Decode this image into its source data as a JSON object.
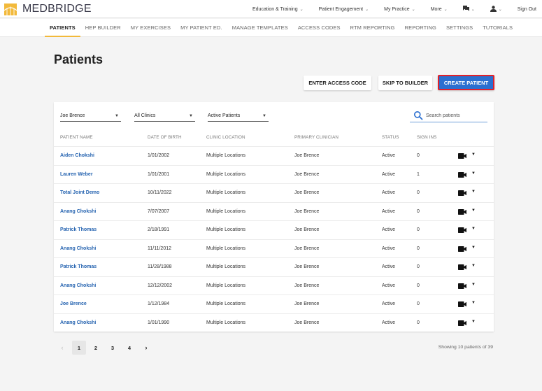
{
  "brand": {
    "name": "MEDBRIDGE",
    "logo_icon": "medbridge-bridge-logo",
    "logo_color": "#f2b93b"
  },
  "topnav": {
    "items": [
      {
        "label": "Education & Training",
        "has_dropdown": true
      },
      {
        "label": "Patient Engagement",
        "has_dropdown": true
      },
      {
        "label": "My Practice",
        "has_dropdown": true
      },
      {
        "label": "More",
        "has_dropdown": true
      }
    ],
    "messages_icon": "chat-icon",
    "user_icon": "user-icon",
    "chevron": "⌄",
    "sign_out": "Sign Out"
  },
  "subnav": {
    "tabs": [
      {
        "label": "PATIENTS",
        "active": true
      },
      {
        "label": "HEP BUILDER"
      },
      {
        "label": "MY EXERCISES"
      },
      {
        "label": "MY PATIENT ED."
      },
      {
        "label": "MANAGE TEMPLATES"
      },
      {
        "label": "ACCESS CODES"
      },
      {
        "label": "RTM REPORTING"
      },
      {
        "label": "REPORTING"
      },
      {
        "label": "SETTINGS"
      },
      {
        "label": "TUTORIALS"
      }
    ],
    "active_color": "#f2b93b"
  },
  "page": {
    "title": "Patients"
  },
  "actions": {
    "enter_access_code": "ENTER ACCESS CODE",
    "skip_to_builder": "SKIP TO BUILDER",
    "create_patient": "CREATE PATIENT",
    "create_color": "#2b6fd0"
  },
  "filters": {
    "clinician": "Joe Brence",
    "clinic": "All Clinics",
    "patient_status": "Active Patients",
    "arrow": "▼",
    "search_placeholder": "Search patients"
  },
  "table": {
    "columns": [
      "PATIENT NAME",
      "DATE OF BIRTH",
      "CLINIC LOCATION",
      "PRIMARY CLINICIAN",
      "STATUS",
      "SIGN INS"
    ],
    "rows": [
      {
        "name": "Aiden Chokshi",
        "dob": "1/01/2002",
        "location": "Multiple Locations",
        "clinician": "Joe Brence",
        "status": "Active",
        "sign_ins": "0"
      },
      {
        "name": "Lauren Weber",
        "dob": "1/01/2001",
        "location": "Multiple Locations",
        "clinician": "Joe Brence",
        "status": "Active",
        "sign_ins": "1"
      },
      {
        "name": "Total Joint Demo",
        "dob": "10/11/2022",
        "location": "Multiple Locations",
        "clinician": "Joe Brence",
        "status": "Active",
        "sign_ins": "0"
      },
      {
        "name": "Anang Chokshi",
        "dob": "7/07/2007",
        "location": "Multiple Locations",
        "clinician": "Joe Brence",
        "status": "Active",
        "sign_ins": "0"
      },
      {
        "name": "Patrick Thomas",
        "dob": "2/18/1991",
        "location": "Multiple Locations",
        "clinician": "Joe Brence",
        "status": "Active",
        "sign_ins": "0"
      },
      {
        "name": "Anang Chokshi",
        "dob": "11/11/2012",
        "location": "Multiple Locations",
        "clinician": "Joe Brence",
        "status": "Active",
        "sign_ins": "0"
      },
      {
        "name": "Patrick Thomas",
        "dob": "11/28/1988",
        "location": "Multiple Locations",
        "clinician": "Joe Brence",
        "status": "Active",
        "sign_ins": "0"
      },
      {
        "name": "Anang Chokshi",
        "dob": "12/12/2002",
        "location": "Multiple Locations",
        "clinician": "Joe Brence",
        "status": "Active",
        "sign_ins": "0"
      },
      {
        "name": "Joe Brence",
        "dob": "1/12/1984",
        "location": "Multiple Locations",
        "clinician": "Joe Brence",
        "status": "Active",
        "sign_ins": "0"
      },
      {
        "name": "Anang Chokshi",
        "dob": "1/01/1990",
        "location": "Multiple Locations",
        "clinician": "Joe Brence",
        "status": "Active",
        "sign_ins": "0"
      }
    ],
    "row_action_icon": "video-camera-icon",
    "row_menu_glyph": "▼"
  },
  "pagination": {
    "prev": "‹",
    "pages": [
      "1",
      "2",
      "3",
      "4"
    ],
    "current": "1",
    "next": "›",
    "summary": "Showing 10 patients of 39"
  }
}
